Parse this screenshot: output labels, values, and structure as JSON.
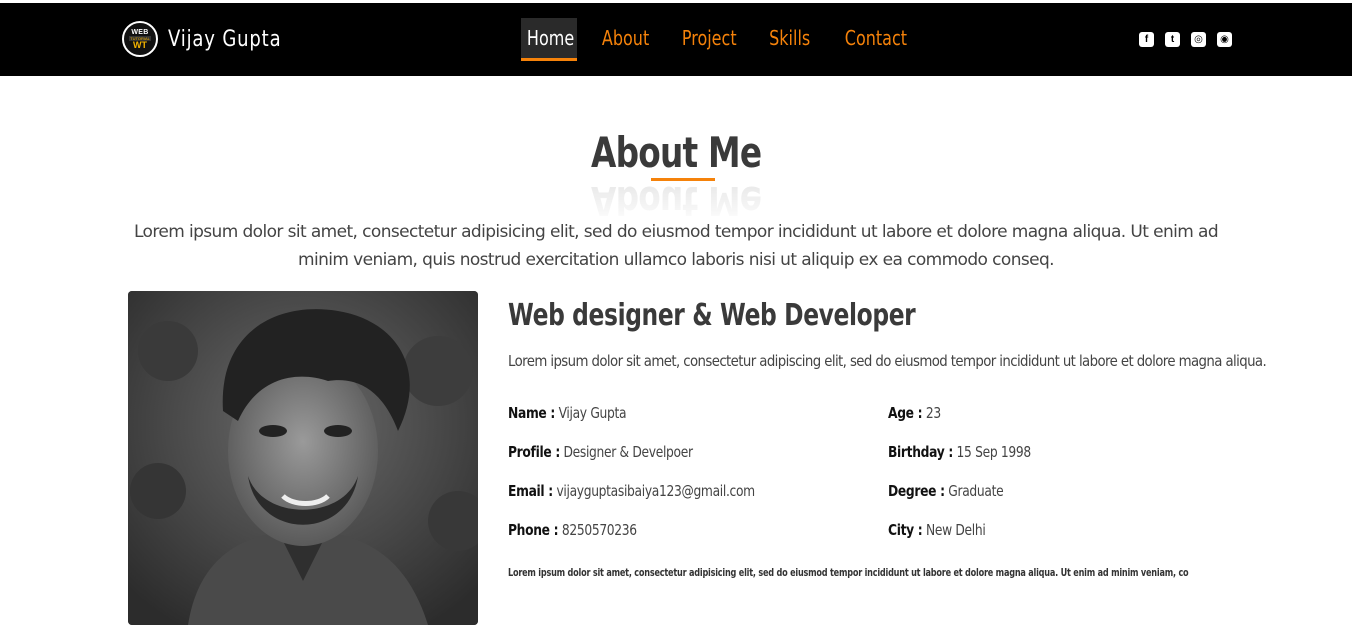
{
  "brand": {
    "logo_line1": "WEB",
    "logo_line2": "TUTORIAL",
    "logo_line3": "WT",
    "name": "Vijay Gupta"
  },
  "nav": {
    "items": [
      {
        "label": "Home",
        "active": true
      },
      {
        "label": "About",
        "active": false
      },
      {
        "label": "Project",
        "active": false
      },
      {
        "label": "Skills",
        "active": false
      },
      {
        "label": "Contact",
        "active": false
      }
    ]
  },
  "socials": [
    {
      "icon": "facebook-icon",
      "glyph": "f"
    },
    {
      "icon": "twitter-icon",
      "glyph": "t"
    },
    {
      "icon": "instagram-icon",
      "glyph": "◎"
    },
    {
      "icon": "github-icon",
      "glyph": "◉"
    }
  ],
  "about": {
    "title": "About Me",
    "intro": "Lorem ipsum dolor sit amet, consectetur adipisicing elit, sed do eiusmod tempor incididunt ut labore et dolore magna aliqua. Ut enim ad minim veniam, quis nostrud exercitation ullamco laboris nisi ut aliquip ex ea commodo conseq.",
    "role": "Web designer & Web Developer",
    "role_desc": "Lorem ipsum dolor sit amet, consectetur adipiscing elit, sed do eiusmod tempor incididunt ut labore et dolore magna aliqua.",
    "details": {
      "name": {
        "key": "Name :",
        "value": "Vijay Gupta"
      },
      "profile": {
        "key": "Profile :",
        "value": "Designer & Develpoer"
      },
      "email": {
        "key": "Email :",
        "value": "vijayguptasibaiya123@gmail.com"
      },
      "phone": {
        "key": "Phone :",
        "value": "8250570236"
      },
      "age": {
        "key": "Age :",
        "value": "23"
      },
      "birthday": {
        "key": "Birthday :",
        "value": "15 Sep 1998"
      },
      "degree": {
        "key": "Degree :",
        "value": "Graduate"
      },
      "city": {
        "key": "City :",
        "value": "New Delhi"
      }
    },
    "fine_print": "Lorem ipsum dolor sit amet, consectetur adipisicing elit, sed do eiusmod tempor incididunt ut labore et dolore magna aliqua. Ut enim ad minim veniam, co"
  },
  "colors": {
    "accent": "#f5820a",
    "navbar": "#000000",
    "text": "#3a3a3a"
  }
}
